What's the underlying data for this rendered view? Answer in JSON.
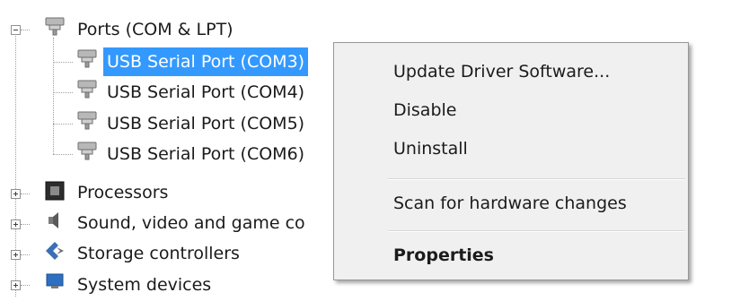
{
  "tree": {
    "ports": {
      "label": "Ports (COM & LPT)",
      "expanded": true
    },
    "children": [
      {
        "label": "USB Serial Port (COM3)",
        "selected": true
      },
      {
        "label": "USB Serial Port (COM4)"
      },
      {
        "label": "USB Serial Port (COM5)"
      },
      {
        "label": "USB Serial Port (COM6)"
      }
    ],
    "siblings": [
      {
        "label": "Processors",
        "icon": "processor-icon"
      },
      {
        "label": "Sound, video and game co",
        "icon": "speaker-icon"
      },
      {
        "label": "Storage controllers",
        "icon": "storage-controller-icon"
      },
      {
        "label": "System devices",
        "icon": "system-devices-icon"
      }
    ]
  },
  "context_menu": {
    "items": [
      {
        "label": "Update Driver Software..."
      },
      {
        "label": "Disable"
      },
      {
        "label": "Uninstall"
      },
      {
        "label": "Scan for hardware changes"
      },
      {
        "label": "Properties",
        "bold": true
      }
    ]
  },
  "colors": {
    "selection": "#3399ff",
    "menu_background": "#f0f0f0"
  }
}
